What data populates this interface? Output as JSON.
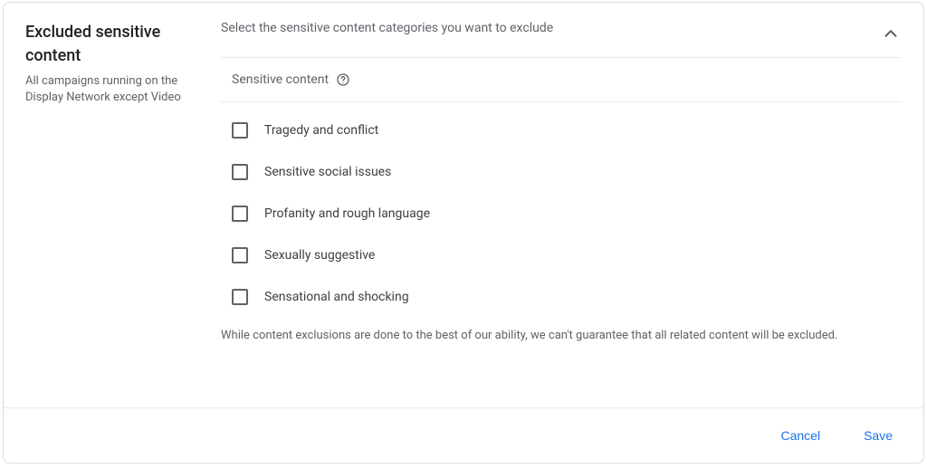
{
  "section": {
    "title": "Excluded sensitive content",
    "subtitle": "All campaigns running on the Display Network except Video"
  },
  "instruction": "Select the sensitive content categories you want to exclude",
  "group_label": "Sensitive content",
  "options": [
    "Tragedy and conflict",
    "Sensitive social issues",
    "Profanity and rough language",
    "Sexually suggestive",
    "Sensational and shocking"
  ],
  "disclaimer": "While content exclusions are done to the best of our ability, we can't guarantee that all related content will be excluded.",
  "buttons": {
    "cancel": "Cancel",
    "save": "Save"
  }
}
